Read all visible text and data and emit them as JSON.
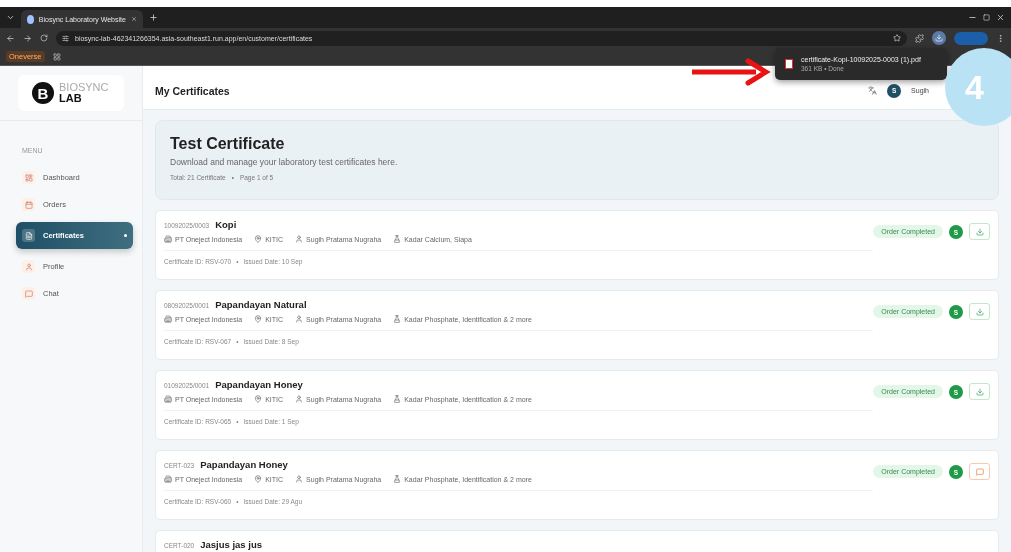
{
  "browser": {
    "tab_title": "Biosync Laboratory Website",
    "url": "biosync-lab-462341266354.asia-southeast1.run.app/en/customer/certificates",
    "bookmark": "Oneverse"
  },
  "download_popup": {
    "file": "certificate-Kopi-10092025-0003 (1).pdf",
    "status": "361 KB • Done"
  },
  "annotation": {
    "step": "4"
  },
  "logo": {
    "mark": "B",
    "line1": "BIOSYNC",
    "line2": "LAB"
  },
  "sidebar": {
    "heading": "MENU",
    "items": [
      {
        "label": "Dashboard",
        "selected": false
      },
      {
        "label": "Orders",
        "selected": false
      },
      {
        "label": "Certificates",
        "selected": true
      },
      {
        "label": "Profile",
        "selected": false
      },
      {
        "label": "Chat",
        "selected": false
      }
    ]
  },
  "header": {
    "title": "My Certificates",
    "avatar": "S",
    "user": "Sugih"
  },
  "banner": {
    "title": "Test Certificate",
    "subtitle": "Download and manage your laboratory test certificates here.",
    "total": "Total: 21 Certificate",
    "sep": "•",
    "page": "Page 1 of 5"
  },
  "certificates": [
    {
      "code": "10092025/0003",
      "name": "Kopi",
      "company": "PT Oneject Indonesia",
      "location": "KITIC",
      "person": "Sugih Pratama Nugraha",
      "tests": "Kadar Calcium, Siapa",
      "cert_id": "Certificate ID: RSV-070",
      "sep": "•",
      "issued": "Issued Date: 10 Sep",
      "status": "Order Completed",
      "avatar": "S",
      "kind": "download"
    },
    {
      "code": "08092025/0001",
      "name": "Papandayan Natural",
      "company": "PT Oneject Indonesia",
      "location": "KITIC",
      "person": "Sugih Pratama Nugraha",
      "tests": "Kadar Phosphate, Identification & 2 more",
      "cert_id": "Certificate ID: RSV-067",
      "sep": "•",
      "issued": "Issued Date: 8 Sep",
      "status": "Order Completed",
      "avatar": "S",
      "kind": "download"
    },
    {
      "code": "01092025/0001",
      "name": "Papandayan Honey",
      "company": "PT Oneject Indonesia",
      "location": "KITIC",
      "person": "Sugih Pratama Nugraha",
      "tests": "Kadar Phosphate, Identification & 2 more",
      "cert_id": "Certificate ID: RSV-065",
      "sep": "•",
      "issued": "Issued Date: 1 Sep",
      "status": "Order Completed",
      "avatar": "S",
      "kind": "download"
    },
    {
      "code": "CERT-023",
      "name": "Papandayan Honey",
      "company": "PT Oneject Indonesia",
      "location": "KITIC",
      "person": "Sugih Pratama Nugraha",
      "tests": "Kadar Phosphate, Identification & 2 more",
      "cert_id": "Certificate ID: RSV-060",
      "sep": "•",
      "issued": "Issued Date: 29 Agu",
      "status": "Order Completed",
      "avatar": "S",
      "kind": "chat"
    },
    {
      "code": "CERT-020",
      "name": "Jasjus jas jus"
    }
  ]
}
